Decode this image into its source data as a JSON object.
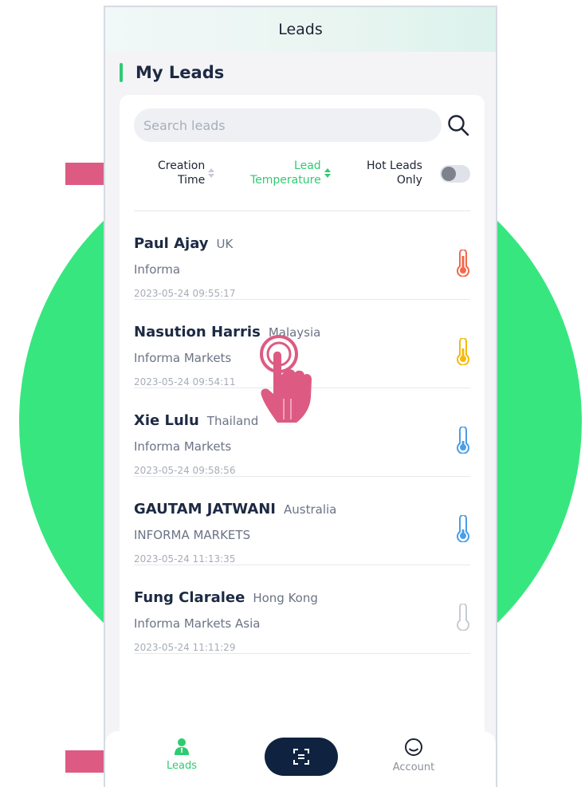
{
  "app": {
    "title": "Leads"
  },
  "section": {
    "title": "My Leads"
  },
  "search": {
    "placeholder": "Search leads",
    "value": ""
  },
  "filters": {
    "creation_time_line1": "Creation",
    "creation_time_line2": "Time",
    "lead_temperature_line1": "Lead",
    "lead_temperature_line2": "Temperature",
    "hot_leads_line1": "Hot Leads",
    "hot_leads_line2": "Only",
    "hot_leads_enabled": false,
    "active_sort": "Lead Temperature"
  },
  "leads": [
    {
      "name": "Paul Ajay",
      "country": "UK",
      "company": "Informa",
      "time": "2023-05-24 09:55:17",
      "temperature": "hot",
      "thermo_color": "#f0694a"
    },
    {
      "name": "Nasution Harris",
      "country": "Malaysia",
      "company": "Informa Markets",
      "time": "2023-05-24 09:54:11",
      "temperature": "warm",
      "thermo_color": "#f5b90f"
    },
    {
      "name": "Xie Lulu",
      "country": "Thailand",
      "company": "Informa Markets",
      "time": "2023-05-24 09:58:56",
      "temperature": "cold",
      "thermo_color": "#4a9ee6"
    },
    {
      "name": "GAUTAM JATWANI",
      "country": "Australia",
      "company": "INFORMA MARKETS",
      "time": "2023-05-24 11:13:35",
      "temperature": "cold",
      "thermo_color": "#4a9ee6"
    },
    {
      "name": "Fung Claralee",
      "country": "Hong Kong",
      "company": "Informa Markets Asia",
      "time": "2023-05-24 11:11:29",
      "temperature": "none",
      "thermo_color": "#c8ccd3"
    }
  ],
  "nav": {
    "leads_label": "Leads",
    "account_label": "Account"
  },
  "colors": {
    "accent": "#2ecc71",
    "indicator": "#dd5b83",
    "background_circle": "#37e67f",
    "scan_button": "#0f2340"
  }
}
